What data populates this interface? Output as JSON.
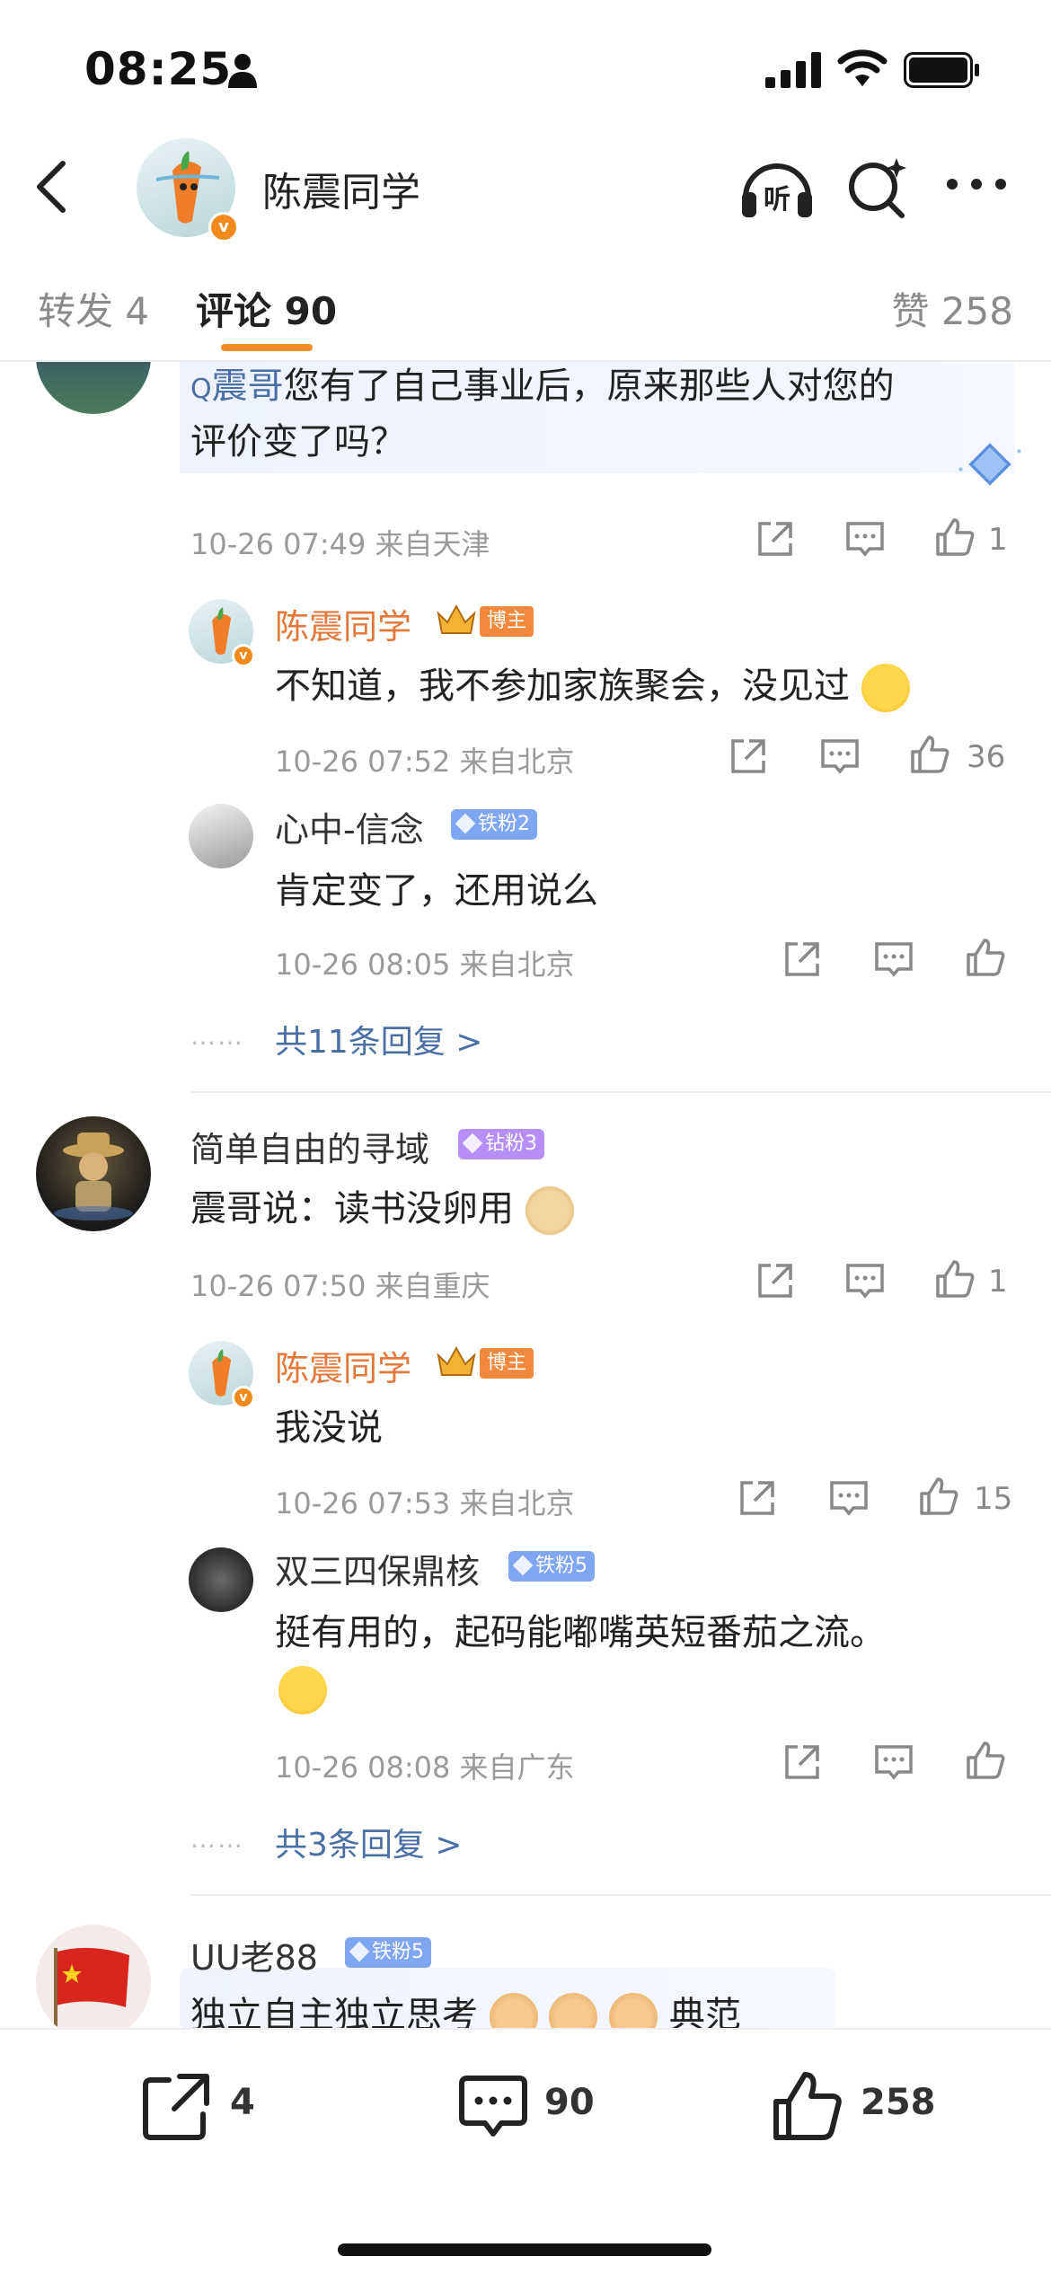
{
  "status_bar": {
    "time": "08:25"
  },
  "header": {
    "title": "陈震同学"
  },
  "tabs": [
    {
      "label": "转发 4"
    },
    {
      "label": "评论 90"
    },
    {
      "label": "赞 258"
    }
  ],
  "comments": [
    {
      "text_prefix": "Q",
      "text_hl": "震哥",
      "text_line1": "您有了自己事业后，原来那些人对您的",
      "text_line2": "评价变了吗？",
      "meta": "10-26 07:49  来自天津",
      "likes": "1",
      "replies": [
        {
          "user": "陈震同学",
          "host": "博主",
          "text": "不知道，我不参加家族聚会，没见过",
          "meta": "10-26 07:52  来自北京",
          "likes": "36"
        },
        {
          "user": "心中-信念",
          "badge": "铁粉2",
          "text": "肯定变了，还用说么",
          "meta": "10-26 08:05  来自北京",
          "likes": ""
        }
      ],
      "more": "共11条回复 >"
    },
    {
      "user": "简单自由的寻域",
      "badge": "钻粉3",
      "text": "震哥说：读书没卵用",
      "meta": "10-26 07:50  来自重庆",
      "likes": "1",
      "replies": [
        {
          "user": "陈震同学",
          "host": "博主",
          "text": "我没说",
          "meta": "10-26 07:53  来自北京",
          "likes": "15"
        },
        {
          "user": "双三四保鼎核",
          "badge": "铁粉5",
          "text": "挺有用的，起码能嘟嘴英短番茄之流。",
          "meta": "10-26 08:08  来自广东",
          "likes": ""
        }
      ],
      "more": "共3条回复 >"
    },
    {
      "user": "UU老88",
      "badge": "铁粉5",
      "text_a": "独立自主独立思考",
      "text_b": "典范"
    }
  ],
  "bottom_bar": {
    "reposts": "4",
    "comments": "90",
    "likes": "258"
  },
  "colors": {
    "accent": "#f28c2a",
    "blogger_name": "#e3783a",
    "link": "#4a6fa5",
    "iron_badge": "#7fa6f1",
    "diamond_badge": "#b68ef5"
  },
  "icons": [
    "person-icon",
    "signal-icon",
    "wifi-icon",
    "battery-icon",
    "back-icon",
    "listen-icon",
    "search-sparkle-icon",
    "more-icon",
    "share-icon",
    "comment-icon",
    "thumbs-up-icon"
  ]
}
